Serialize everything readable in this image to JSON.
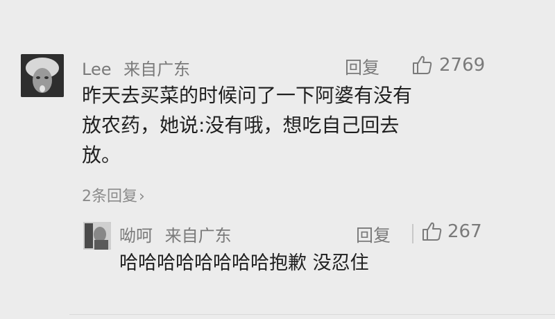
{
  "comment": {
    "username": "Lee",
    "location": "来自广东",
    "reply_label": "回复",
    "like_count": "2769",
    "text_lines": [
      "昨天去买菜的时候问了一下阿婆有没有",
      "放农药，她说:没有哦，想吃自己回去",
      "放。"
    ],
    "replies_link": "2条回复",
    "replies_chevron": "›"
  },
  "reply": {
    "username": "呦呵",
    "location": "来自广东",
    "reply_label": "回复",
    "like_count": "267",
    "text": "哈哈哈哈哈哈哈哈抱歉 没忍住"
  },
  "icons": {
    "like": "thumbs-up-outline",
    "replies_chevron": "chevron-right"
  },
  "colors": {
    "background": "#ececec",
    "meta_text": "#7a7a7a",
    "body_text": "#1f1f1f"
  }
}
